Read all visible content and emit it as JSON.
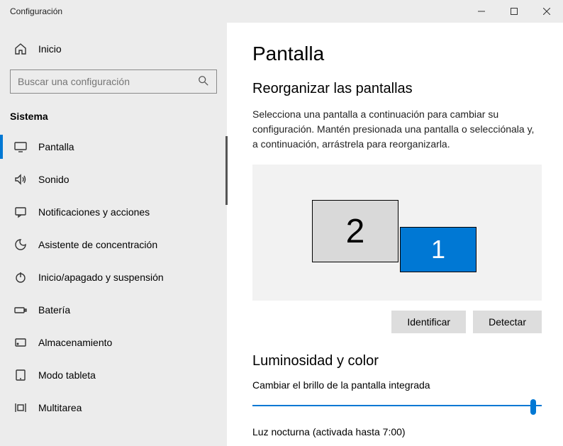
{
  "window": {
    "title": "Configuración"
  },
  "sidebar": {
    "home": "Inicio",
    "search_placeholder": "Buscar una configuración",
    "section": "Sistema",
    "items": [
      {
        "label": "Pantalla",
        "icon": "display-icon",
        "active": true
      },
      {
        "label": "Sonido",
        "icon": "sound-icon",
        "active": false
      },
      {
        "label": "Notificaciones y acciones",
        "icon": "notifications-icon",
        "active": false
      },
      {
        "label": "Asistente de concentración",
        "icon": "focus-assist-icon",
        "active": false
      },
      {
        "label": "Inicio/apagado y suspensión",
        "icon": "power-sleep-icon",
        "active": false
      },
      {
        "label": "Batería",
        "icon": "battery-icon",
        "active": false
      },
      {
        "label": "Almacenamiento",
        "icon": "storage-icon",
        "active": false
      },
      {
        "label": "Modo tableta",
        "icon": "tablet-mode-icon",
        "active": false
      },
      {
        "label": "Multitarea",
        "icon": "multitasking-icon",
        "active": false
      }
    ]
  },
  "main": {
    "title": "Pantalla",
    "rearrange": {
      "heading": "Reorganizar las pantallas",
      "description": "Selecciona una pantalla a continuación para cambiar su configuración. Mantén presionada una pantalla o selecciónala y, a continuación, arrástrela para reorganizarla.",
      "displays": [
        {
          "id": "2",
          "selected": false
        },
        {
          "id": "1",
          "selected": true
        }
      ],
      "identify_label": "Identificar",
      "detect_label": "Detectar"
    },
    "brightness": {
      "heading": "Luminosidad y color",
      "slider_label": "Cambiar el brillo de la pantalla integrada",
      "slider_value": 98,
      "night_light": "Luz nocturna (activada hasta 7:00)"
    }
  }
}
